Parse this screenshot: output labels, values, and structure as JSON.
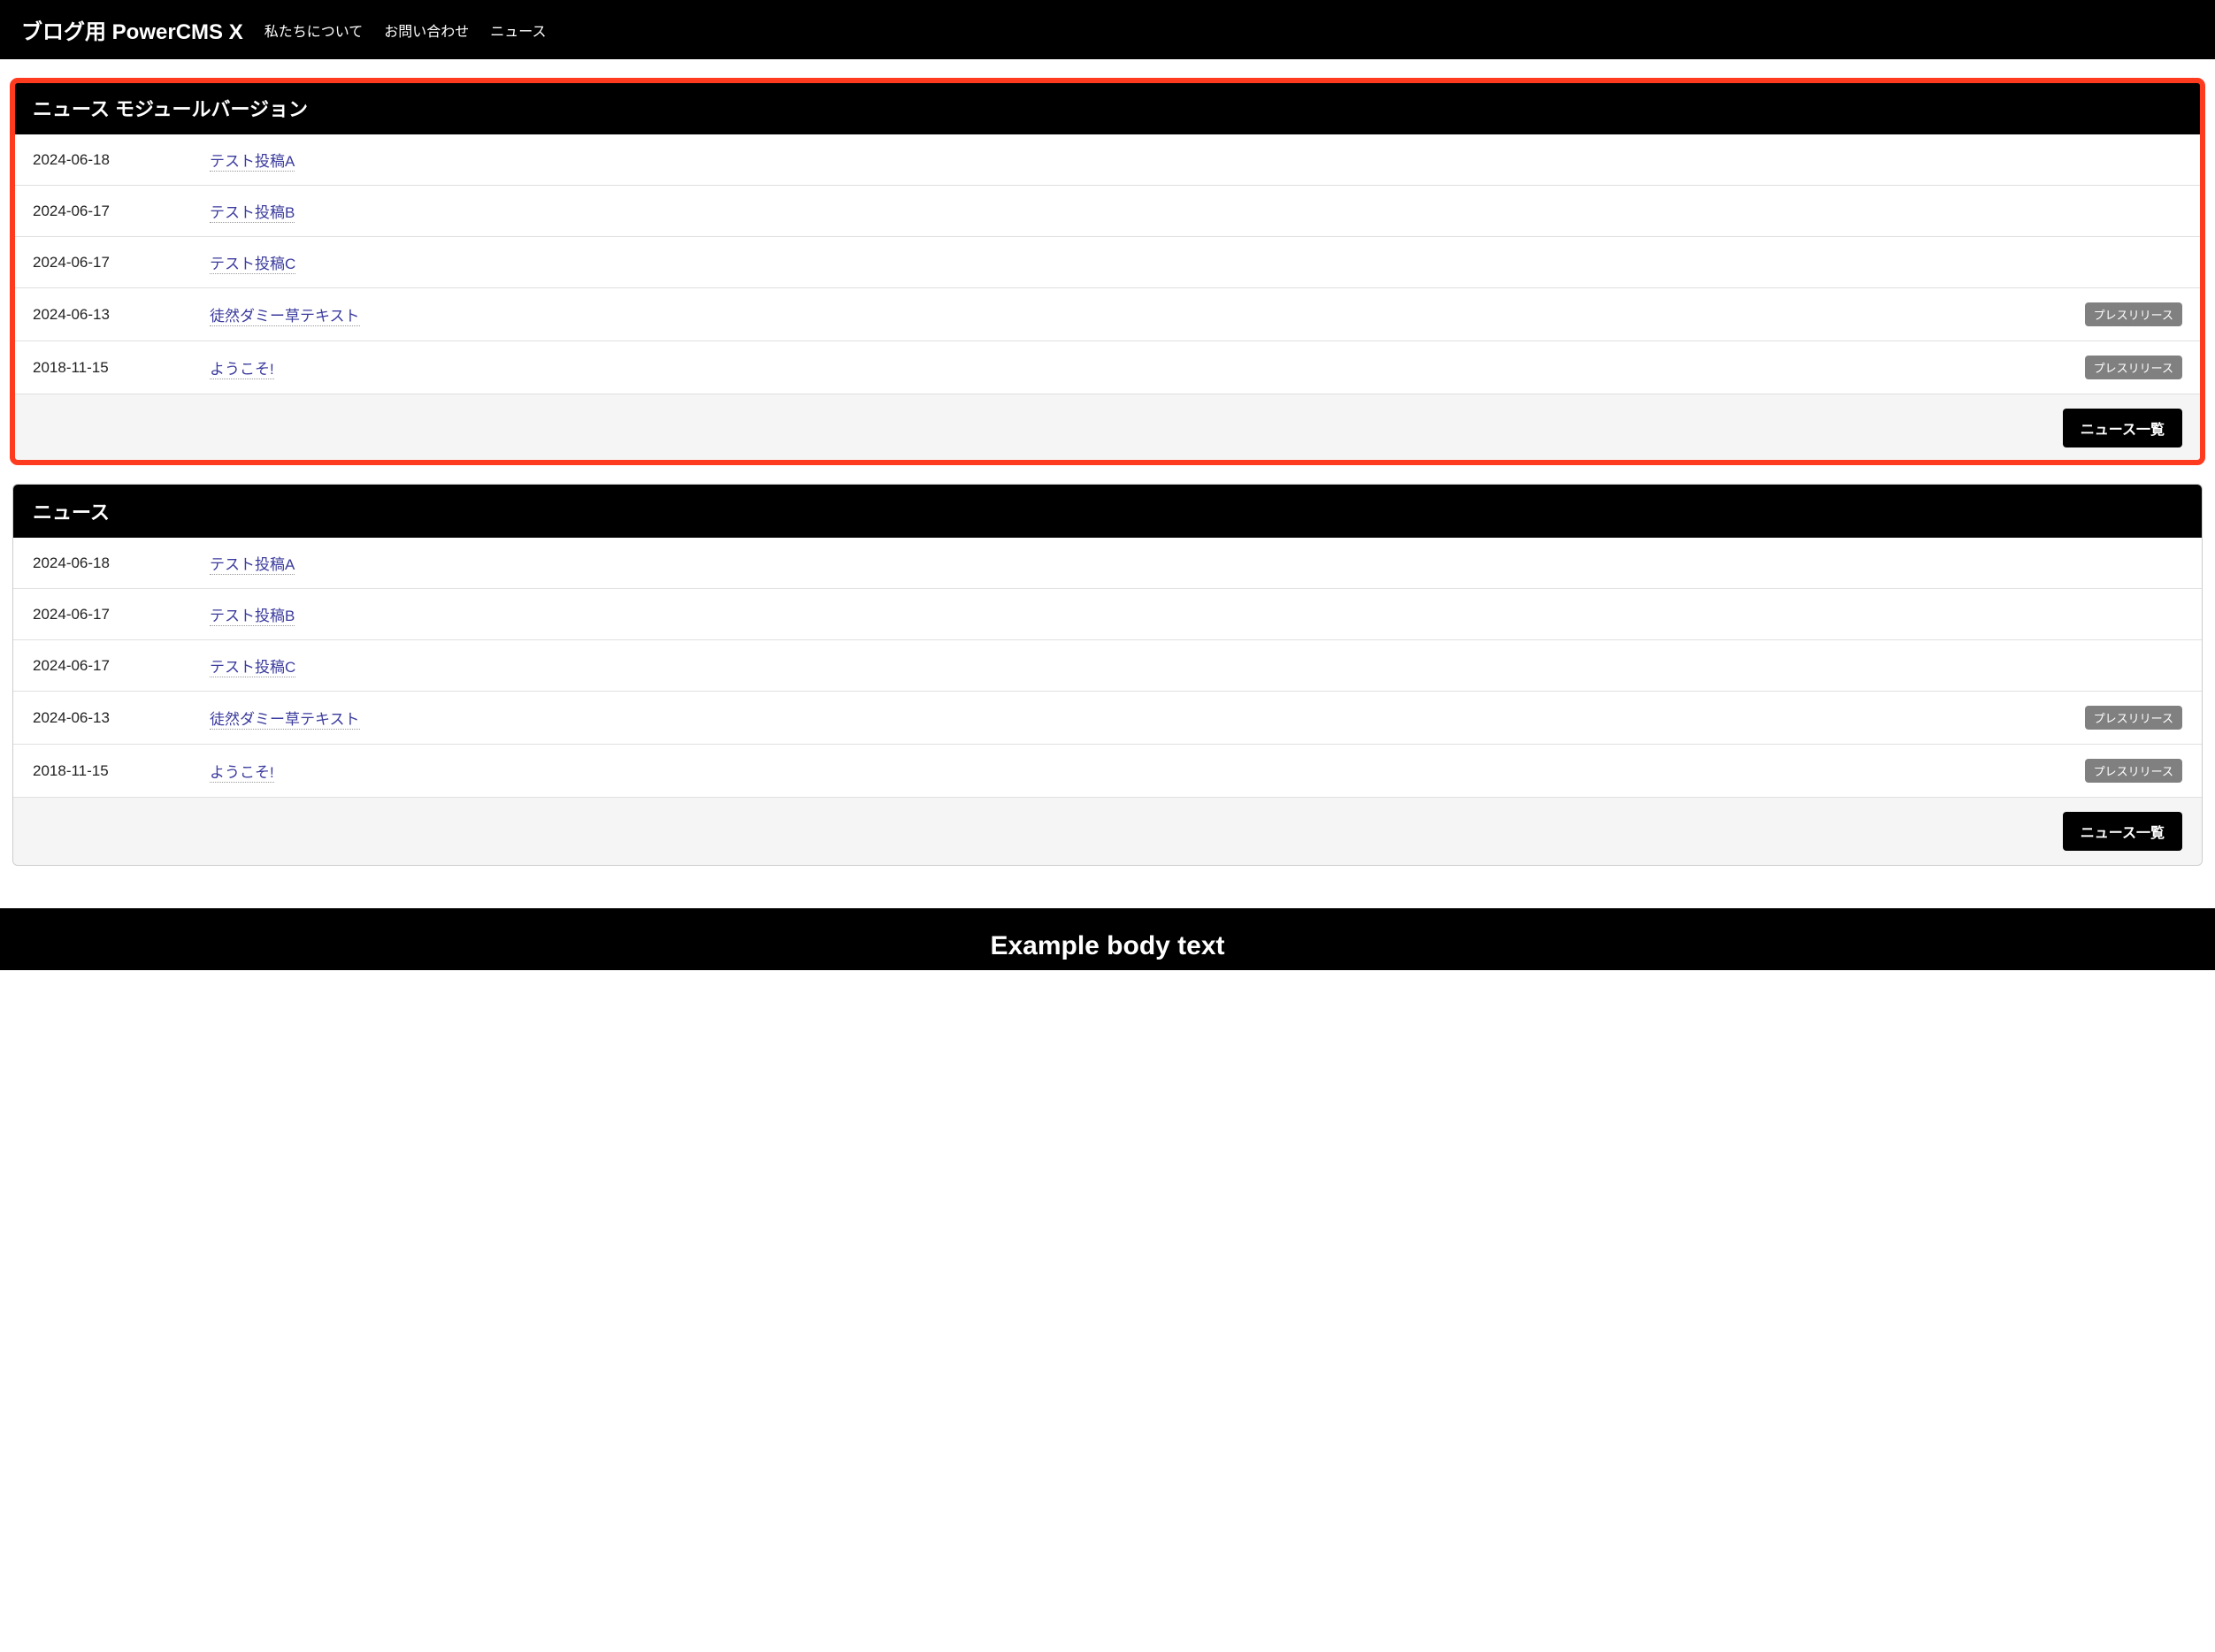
{
  "nav": {
    "brand": "ブログ用 PowerCMS X",
    "links": [
      "私たちについて",
      "お問い合わせ",
      "ニュース"
    ]
  },
  "panels": [
    {
      "title": "ニュース モジュールバージョン",
      "highlighted": true,
      "items": [
        {
          "date": "2024-06-18",
          "title": "テスト投稿A",
          "badge": null
        },
        {
          "date": "2024-06-17",
          "title": "テスト投稿B",
          "badge": null
        },
        {
          "date": "2024-06-17",
          "title": "テスト投稿C",
          "badge": null
        },
        {
          "date": "2024-06-13",
          "title": "徒然ダミー草テキスト",
          "badge": "プレスリリース"
        },
        {
          "date": "2018-11-15",
          "title": "ようこそ!",
          "badge": "プレスリリース"
        }
      ],
      "button_label": "ニュース一覧"
    },
    {
      "title": "ニュース",
      "highlighted": false,
      "items": [
        {
          "date": "2024-06-18",
          "title": "テスト投稿A",
          "badge": null
        },
        {
          "date": "2024-06-17",
          "title": "テスト投稿B",
          "badge": null
        },
        {
          "date": "2024-06-17",
          "title": "テスト投稿C",
          "badge": null
        },
        {
          "date": "2024-06-13",
          "title": "徒然ダミー草テキスト",
          "badge": "プレスリリース"
        },
        {
          "date": "2018-11-15",
          "title": "ようこそ!",
          "badge": "プレスリリース"
        }
      ],
      "button_label": "ニュース一覧"
    }
  ],
  "footer": {
    "heading": "Example body text"
  }
}
